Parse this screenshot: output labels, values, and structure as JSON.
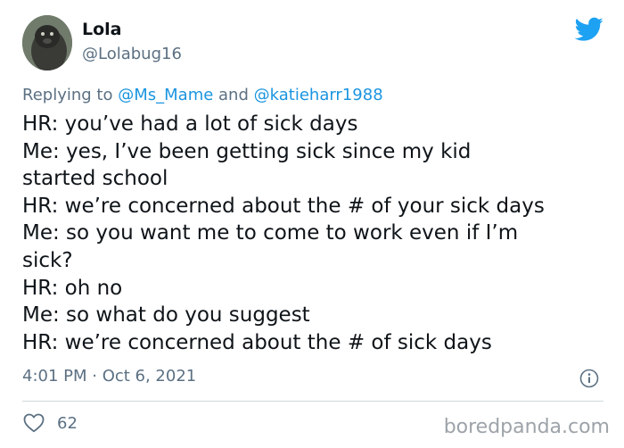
{
  "tweet": {
    "author_name": "Lola",
    "author_handle": "@Lolabug16",
    "replying_prefix": "Replying to",
    "reply_mention_1": "@Ms_Mame",
    "reply_joiner": "and",
    "reply_mention_2": "@katieharr1988",
    "lines": [
      "HR: you’ve had a lot of sick days",
      "Me: yes, I’ve been getting sick since my kid",
      "started school",
      "HR: we’re concerned about the # of your sick days",
      "Me: so you want me to come to work even if I’m",
      "sick?",
      "HR: oh no",
      "Me: so what do you suggest",
      "HR: we’re concerned about the # of sick days"
    ],
    "timestamp": "4:01 PM · Oct 6, 2021",
    "like_count": "62"
  },
  "watermark": "boredpanda.com",
  "icons": {
    "platform": "twitter-bird-icon",
    "info": "info-icon",
    "like": "heart-icon"
  },
  "colors": {
    "brand": "#1da1f2",
    "mention": "#1b95e0",
    "secondary_text": "#5b7083",
    "primary_text": "#0f1419"
  }
}
